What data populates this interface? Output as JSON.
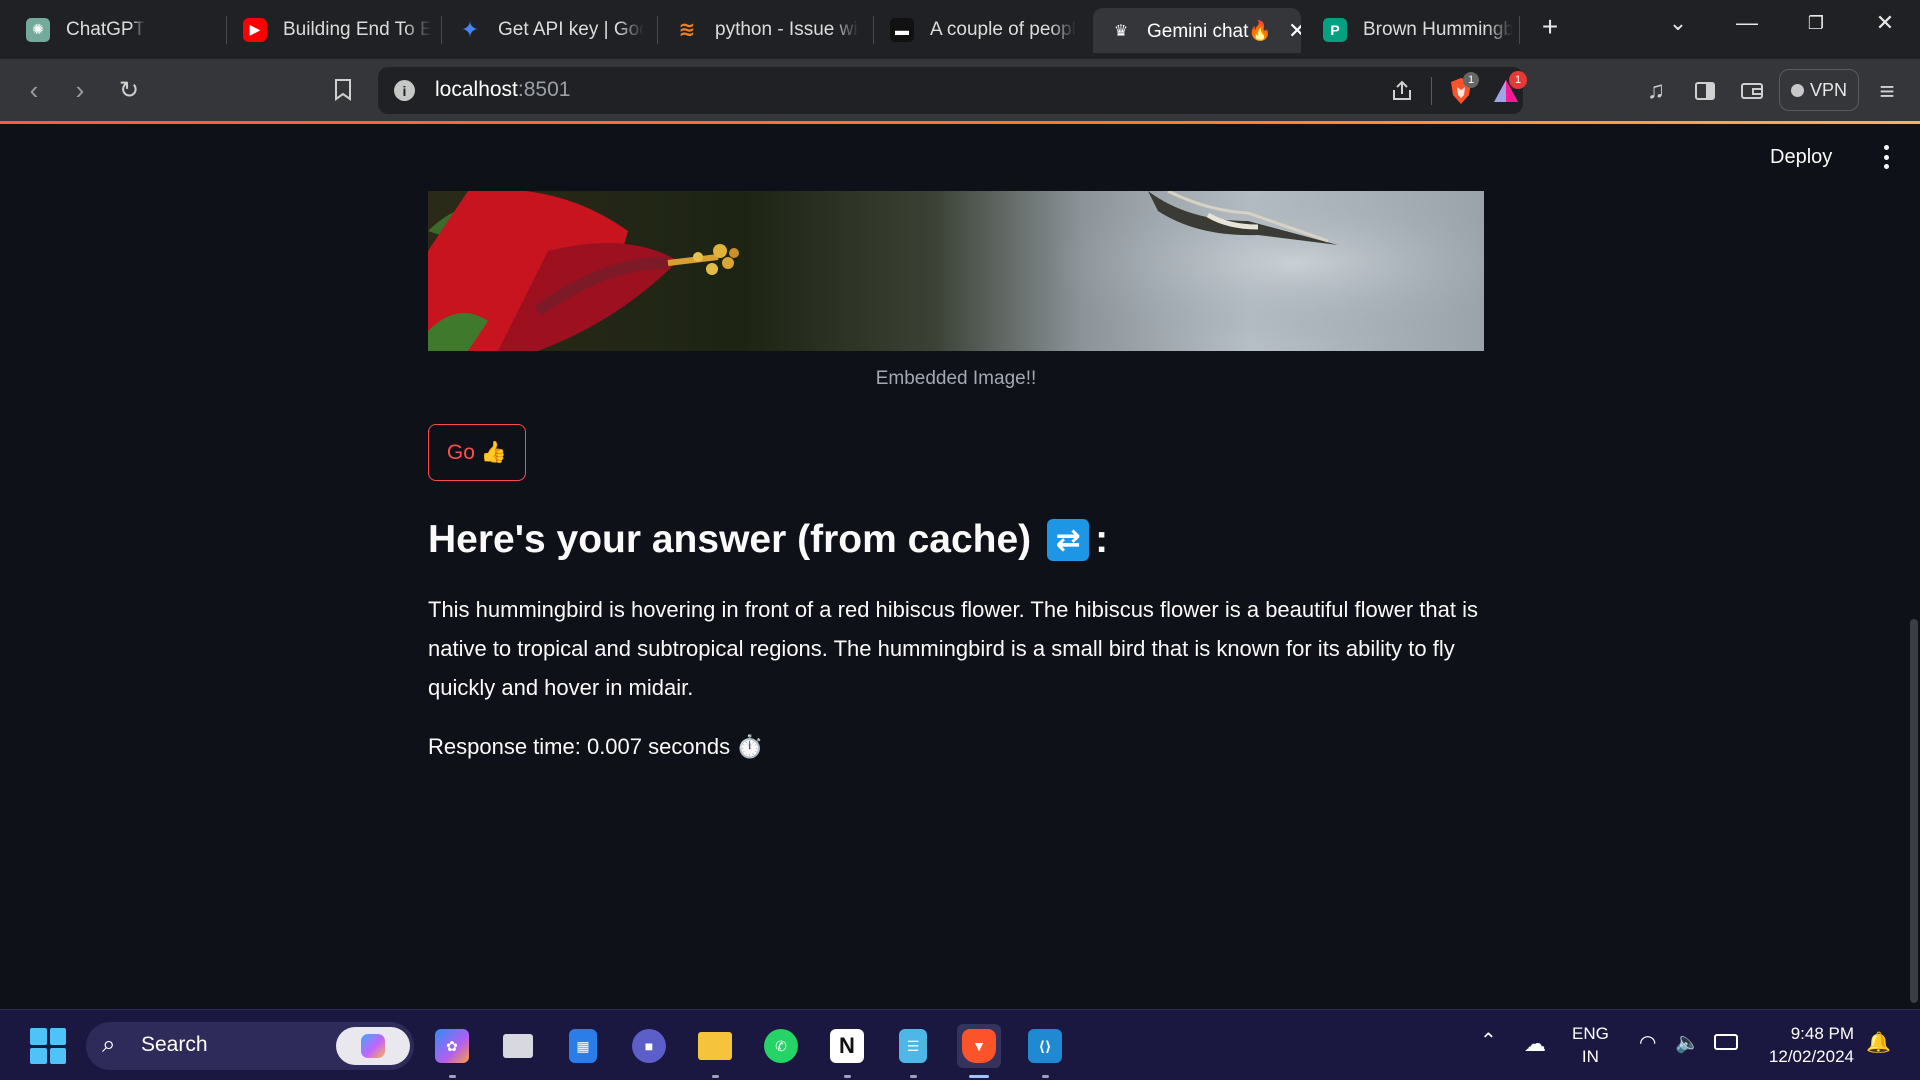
{
  "browser": {
    "tabs": [
      {
        "title": "ChatGPT",
        "icon": "chatgpt-icon",
        "color": "#74aa9c"
      },
      {
        "title": "Building End To En",
        "icon": "youtube-icon",
        "color": "#ff0000"
      },
      {
        "title": "Get API key | Goog",
        "icon": "ai-studio-icon",
        "color": "#4285f4"
      },
      {
        "title": "python - Issue with",
        "icon": "stackoverflow-icon",
        "color": "#f48024"
      },
      {
        "title": "A couple of people",
        "icon": "unsplash-icon",
        "color": "#111111"
      },
      {
        "title": "Gemini chat🔥",
        "icon": "streamlit-crown-icon",
        "color": "#ffffff",
        "active": true
      },
      {
        "title": "Brown Hummingb",
        "icon": "pexels-icon",
        "color": "#05a081"
      }
    ],
    "address": {
      "host": "localhost",
      "port": ":8501"
    },
    "vpn_label": "VPN",
    "shields_count": "1",
    "rewards_count": "1"
  },
  "app": {
    "deploy_label": "Deploy",
    "image_caption": "Embedded Image!!",
    "go_button": {
      "label": "Go",
      "emoji": "👍"
    },
    "answer_heading": "Here's your answer (from cache)",
    "answer_heading_emoji": "🔄",
    "answer_heading_suffix": ":",
    "answer_text": "This hummingbird is hovering in front of a red hibiscus flower. The hibiscus flower is a beautiful flower that is native to tropical and subtropical regions. The hummingbird is a small bird that is known for its ability to fly quickly and hover in midair.",
    "response_time": "Response time: 0.007 seconds",
    "response_time_emoji": "⏱️"
  },
  "taskbar": {
    "search_label": "Search",
    "language": {
      "line1": "ENG",
      "line2": "IN"
    },
    "time": "9:48 PM",
    "date": "12/02/2024"
  },
  "colors": {
    "accent": "#ff4b4b",
    "page_bg": "#0e1117",
    "refresh_emoji_bg": "#1e96e6"
  }
}
